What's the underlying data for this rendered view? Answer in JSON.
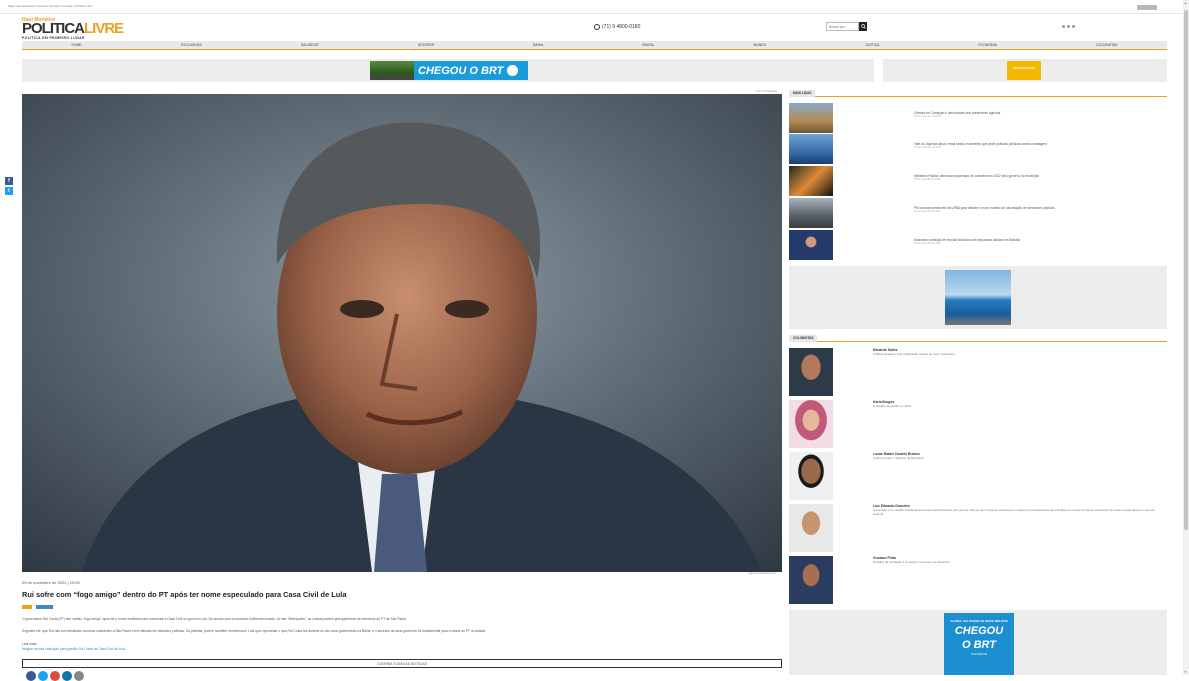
{
  "topbar": {
    "links": "Faça sua assinatura  |  Anuncie conosco  |  Contato  |  Política Livre"
  },
  "logo": {
    "small": "Raul Monteiro",
    "main_a": "POLITICA",
    "main_b": "LIVRE",
    "tagline": "POLÍTICA EM PRIMEIRO LUGAR"
  },
  "phone": "(71) 9 4800-0180",
  "search": {
    "placeholder": "Buscar por..."
  },
  "nav": [
    "Home",
    "Exclusivas",
    "Salvador",
    "Interior",
    "Bahia",
    "Brasil",
    "Mundo",
    "Justiça",
    "Economia",
    "Colunistas"
  ],
  "ads": {
    "banner_text": "CHEGOU O BRT",
    "side_text": "PATROCINADO"
  },
  "article": {
    "photo_credit_top": "Foto: Divulgação",
    "photo_credit_bottom": "Agência Brasil/Arquivo",
    "date": "09 de novembro de 2022 | 10:09",
    "title": "Rui sofre com “fogo amigo” dentro do PT após ter nome especulado para Casa Civil de Lula",
    "p1": "O governador Rui Costa (PT) tem sofrido \"fogo amigo\" após ter o nome ventilado para comandar a Casa Civil do governo Lula. De acordo com a colunista Guilherme Amado, do site \"Metrópoles\", as críticas partem principalmente de membros do PT de São Paulo.",
    "p2": "Segundo ele, que Rui não tem destinado recursos suficientes a São Paulo e tem falhado em decisões políticas. Os petistas, porém, também reconhecem: Lula quer aproveitar o que Rui Costa fez durante os oito anos governando na Bahia, e o sucesso de seus governos foi fundamental para a vitória do PT no estado.",
    "read_label": "Leia mais:",
    "read_link": "Wagner recusa indicação para gestão Rui Costa na Casa Civil de Lula",
    "button": "CONFIRA TODAS AS NOTÍCIAS"
  },
  "mais_lidas": {
    "title": "MAIS LIDAS",
    "items": [
      {
        "text": "Câmara de Camaçari é denunciada pelo parlamento agrícola",
        "date": "09 de novembro de 2022"
      },
      {
        "text": "Vale do Jiquiriçá lança, nesta sexta, movimento que pede políticas públicas contra a estiagem",
        "date": "09 de novembro de 2022"
      },
      {
        "text": "Ministério Público denuncia suspensão de contratos em 2022 pelo governo do município",
        "date": "09 de novembro de 2022"
      },
      {
        "text": "PM convida servidores da UFBA para debater o novo modelo de valorização de servidores públicos",
        "date": "09 de novembro de 2022"
      },
      {
        "text": "Bolsonaro participa de reunião fechada com deputados aliados em Brasília",
        "date": "09 de novembro de 2022"
      }
    ]
  },
  "colunistas": {
    "title": "COLUNISTAS",
    "items": [
      {
        "name": "Eduardo Salles",
        "snippet": "A Bahia agradece pela mobilização política ao meio rural baiano"
      },
      {
        "name": "Karla Borges",
        "snippet": "O desafio da gestão em 2023"
      },
      {
        "name": "Lucas Rafael Castelo Branco",
        "snippet": "Carlos Gomes: o 'Menino' da República"
      },
      {
        "name": "Luiz Eduardo Dorneles",
        "snippet": "A inovação é um desafio fundamental à atual Justiça Eleitoral, que precisa mais do que nunca de mecanismos modernos e transparentes para fiscalizar as novas formas de campanha nas redes sociais durante o período eleitoral."
      },
      {
        "name": "Gustavo Pinto",
        "snippet": "Desafios da tributação e os efeitos nos preços de alimentos"
      }
    ]
  },
  "brt_side": {
    "a": "AGORA, SALVADOR SE MOVE MELHOR",
    "b1": "CHEGOU",
    "b2": "O BRT",
    "c": "SALVADOR"
  },
  "colors": {
    "accent": "#f0a020",
    "brt": "#1b9bd8",
    "facebook": "#3b5998",
    "twitter": "#1da1f2"
  }
}
